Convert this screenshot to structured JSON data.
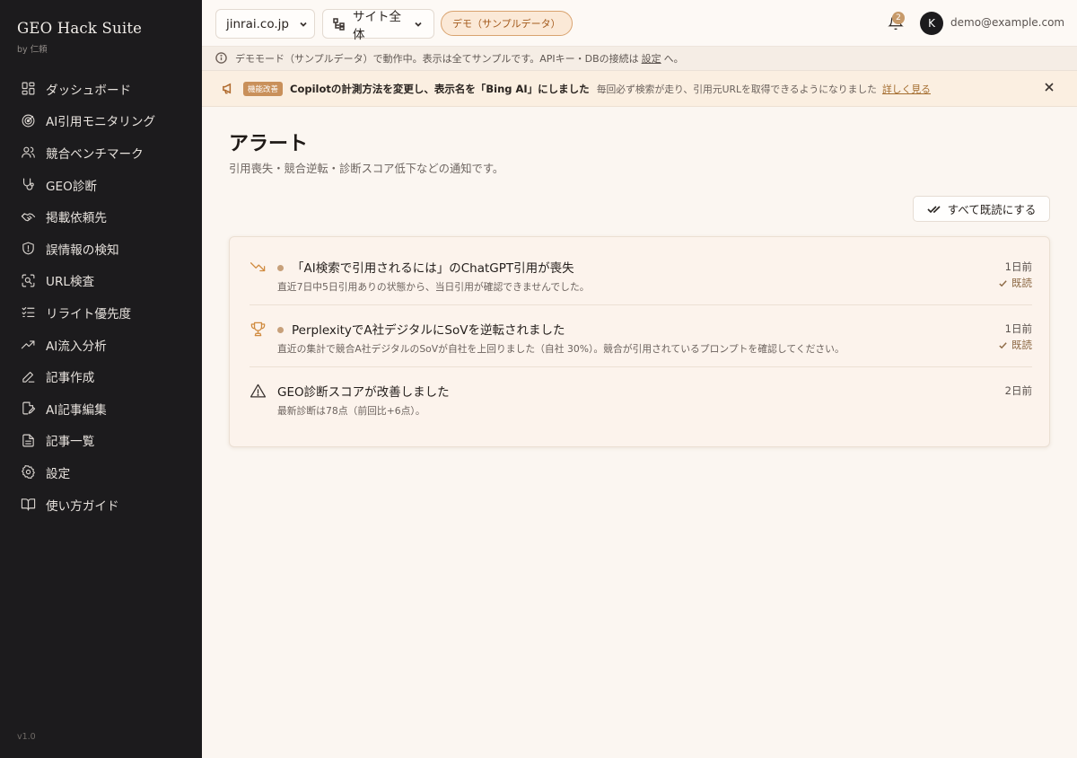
{
  "brand": {
    "title": "GEO Hack Suite",
    "subtitle": "by 仁頼",
    "version": "v1.0"
  },
  "sidebar": {
    "items": [
      {
        "label": "ダッシュボード",
        "icon": "dashboard-icon"
      },
      {
        "label": "AI引用モニタリング",
        "icon": "radar-icon"
      },
      {
        "label": "競合ベンチマーク",
        "icon": "users-icon"
      },
      {
        "label": "GEO診断",
        "icon": "stethoscope-icon"
      },
      {
        "label": "掲載依頼先",
        "icon": "handshake-icon"
      },
      {
        "label": "誤情報の検知",
        "icon": "shield-icon"
      },
      {
        "label": "URL検査",
        "icon": "scan-search-icon"
      },
      {
        "label": "リライト優先度",
        "icon": "list-checks-icon"
      },
      {
        "label": "AI流入分析",
        "icon": "trending-up-icon"
      },
      {
        "label": "記事作成",
        "icon": "pencil-icon"
      },
      {
        "label": "AI記事編集",
        "icon": "file-edit-icon"
      },
      {
        "label": "記事一覧",
        "icon": "file-text-icon"
      },
      {
        "label": "設定",
        "icon": "gear-icon"
      },
      {
        "label": "使い方ガイド",
        "icon": "book-icon"
      }
    ]
  },
  "header": {
    "domain_select": "jinrai.co.jp",
    "scope_select": "サイト全体",
    "demo_badge": "デモ（サンプルデータ）",
    "notification_count": "2",
    "avatar_initial": "K",
    "user_email": "demo@example.com"
  },
  "infobar": {
    "text_before": "デモモード（サンプルデータ）で動作中。表示は全てサンプルです。APIキー・DBの接続は",
    "link": "設定",
    "text_after": "へ。"
  },
  "announcement": {
    "tag": "機能改善",
    "title": "Copilotの計測方法を変更し、表示名を「Bing AI」にしました",
    "body": "毎回必ず検索が走り、引用元URLを取得できるようになりました",
    "link": "詳しく見る"
  },
  "page": {
    "title": "アラート",
    "subtitle": "引用喪失・競合逆転・診断スコア低下などの通知です。",
    "mark_all_read": "すべて既読にする"
  },
  "alerts": [
    {
      "icon": "trending-down-icon",
      "title": "「AI検索で引用されるには」のChatGPT引用が喪失",
      "description": "直近7日中5日引用ありの状態から、当日引用が確認できませんでした。",
      "time": "1日前",
      "read_label": "既読",
      "unread": true
    },
    {
      "icon": "trophy-icon",
      "title": "PerplexityでA社デジタルにSoVを逆転されました",
      "description": "直近の集計で競合A社デジタルのSoVが自社を上回りました（自社 30%）。競合が引用されているプロンプトを確認してください。",
      "time": "1日前",
      "read_label": "既読",
      "unread": true
    },
    {
      "icon": "alert-triangle-icon",
      "title": "GEO診断スコアが改善しました",
      "description": "最新診断は78点（前回比+6点）。",
      "time": "2日前",
      "read_label": "",
      "unread": false
    }
  ],
  "colors": {
    "sidebar_bg": "#1c1b1d",
    "accent": "#c9905a",
    "page_bg": "#fbf6f1"
  }
}
